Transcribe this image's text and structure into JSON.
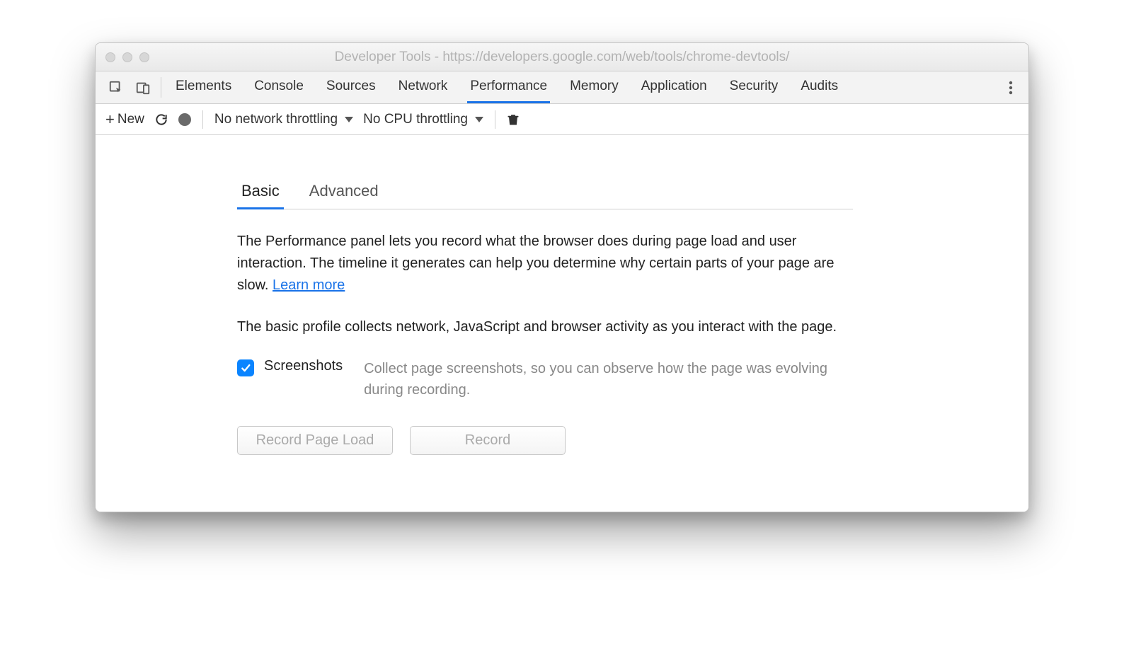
{
  "window": {
    "title": "Developer Tools - https://developers.google.com/web/tools/chrome-devtools/"
  },
  "topTabs": [
    {
      "label": "Elements",
      "active": false
    },
    {
      "label": "Console",
      "active": false
    },
    {
      "label": "Sources",
      "active": false
    },
    {
      "label": "Network",
      "active": false
    },
    {
      "label": "Performance",
      "active": true
    },
    {
      "label": "Memory",
      "active": false
    },
    {
      "label": "Application",
      "active": false
    },
    {
      "label": "Security",
      "active": false
    },
    {
      "label": "Audits",
      "active": false
    }
  ],
  "toolbar": {
    "newLabel": "New",
    "networkThrottle": "No network throttling",
    "cpuThrottle": "No CPU throttling"
  },
  "subTabs": [
    {
      "label": "Basic",
      "active": true
    },
    {
      "label": "Advanced",
      "active": false
    }
  ],
  "main": {
    "desc1_a": "The Performance panel lets you record what the browser does during page load and user interaction. The timeline it generates can help you determine why certain parts of your page are slow.  ",
    "learnMore": "Learn more",
    "desc2": "The basic profile collects network, JavaScript and browser activity as you interact with the page.",
    "option": {
      "checked": true,
      "label": "Screenshots",
      "desc": "Collect page screenshots, so you can observe how the page was evolving during recording."
    },
    "buttons": {
      "recordPageLoad": "Record Page Load",
      "record": "Record"
    }
  }
}
